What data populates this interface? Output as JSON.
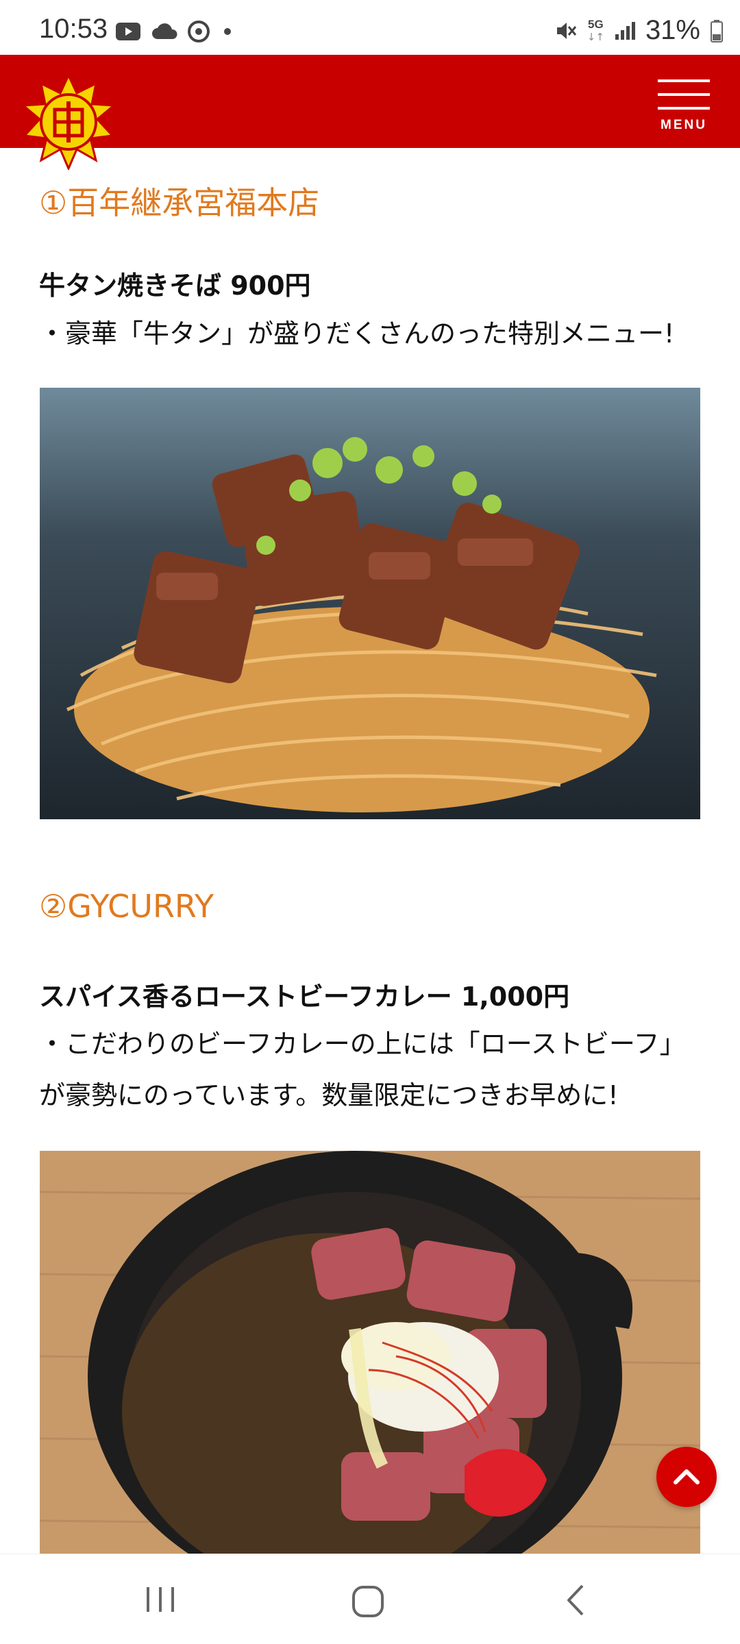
{
  "status_bar": {
    "time": "10:53",
    "battery": "31%",
    "network": "5G",
    "icons": [
      "youtube-icon",
      "cloud-icon",
      "chrome-icon",
      "dot-icon",
      "mute-icon",
      "network-5g-icon",
      "signal-icon",
      "battery-icon"
    ]
  },
  "header": {
    "menu_label": "MENU",
    "brand_color": "#c90000"
  },
  "sections": [
    {
      "heading": "①百年継承宮福本店",
      "item_title": "牛タン焼きそば 900円",
      "description_lines": [
        "・豪華「牛タン」が盛りだくさんのった特別メニュー!"
      ],
      "photo": "yakisoba-with-beef-tongue-photo"
    },
    {
      "heading": "②GYCURRY",
      "item_title": "スパイス香るローストビーフカレー 1,000円",
      "description_lines": [
        "・こだわりのビーフカレーの上には「ローストビーフ」",
        "が豪勢にのっています。数量限定につきお早めに!"
      ],
      "photo": "roast-beef-curry-photo"
    }
  ],
  "colors": {
    "heading": "#e07a1f",
    "back_to_top": "#d50000"
  }
}
